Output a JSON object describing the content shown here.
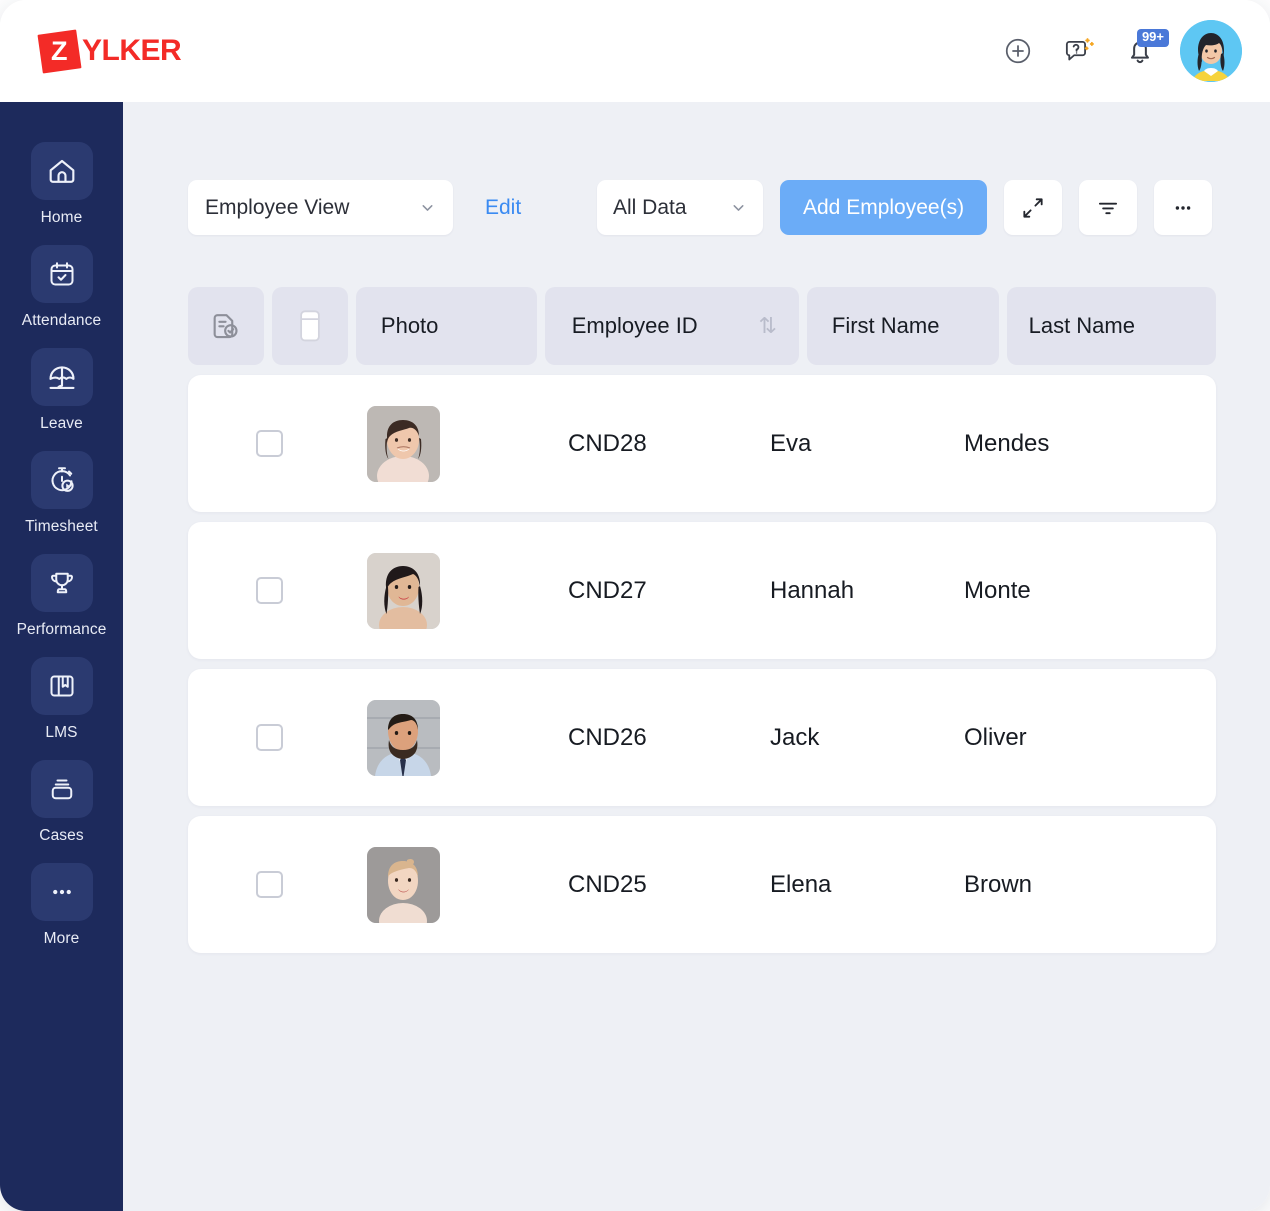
{
  "brand": {
    "mark_letter": "Z",
    "name": "YLKER",
    "color": "#f32b27"
  },
  "header": {
    "actions": [
      {
        "name": "add-icon",
        "label": "Add"
      },
      {
        "name": "help-icon",
        "label": "Help"
      },
      {
        "name": "notifications-icon",
        "label": "Notifications",
        "badge": "99+"
      }
    ],
    "avatar_label": "User profile"
  },
  "sidebar": {
    "items": [
      {
        "label": "Home",
        "icon": "home-icon"
      },
      {
        "label": "Attendance",
        "icon": "calendar-check-icon"
      },
      {
        "label": "Leave",
        "icon": "beach-umbrella-icon"
      },
      {
        "label": "Timesheet",
        "icon": "stopwatch-play-icon"
      },
      {
        "label": "Performance",
        "icon": "trophy-icon"
      },
      {
        "label": "LMS",
        "icon": "book-icon"
      },
      {
        "label": "Cases",
        "icon": "briefcase-icon"
      },
      {
        "label": "More",
        "icon": "ellipsis-icon"
      }
    ]
  },
  "toolbar": {
    "view_value": "Employee View",
    "edit_label": "Edit",
    "data_value": "All Data",
    "add_label": "Add Employee(s)",
    "expand_icon": "expand-arrows-icon",
    "filter_icon": "filter-icon",
    "more_icon": "ellipsis-icon"
  },
  "table": {
    "headers": {
      "record_icon": "document-check-icon",
      "layout_icon": "card-view-icon",
      "photo": "Photo",
      "employee_id": "Employee ID",
      "sort_glyph": "⇅",
      "first_name": "First Name",
      "last_name": "Last Name"
    },
    "rows": [
      {
        "id": "CND28",
        "first": "Eva",
        "last": "Mendes",
        "photo": "woman-brown-hair"
      },
      {
        "id": "CND27",
        "first": "Hannah",
        "last": "Monte",
        "photo": "woman-dark-hair"
      },
      {
        "id": "CND26",
        "first": "Jack",
        "last": "Oliver",
        "photo": "man-beard-tie"
      },
      {
        "id": "CND25",
        "first": "Elena",
        "last": "Brown",
        "photo": "woman-blonde-updo"
      }
    ]
  },
  "colors": {
    "accent": "#6bacf7",
    "sidebar": "#1d2a5c",
    "header_cell": "#e2e3ee",
    "canvas": "#eef0f5",
    "link": "#3b8bf2"
  }
}
